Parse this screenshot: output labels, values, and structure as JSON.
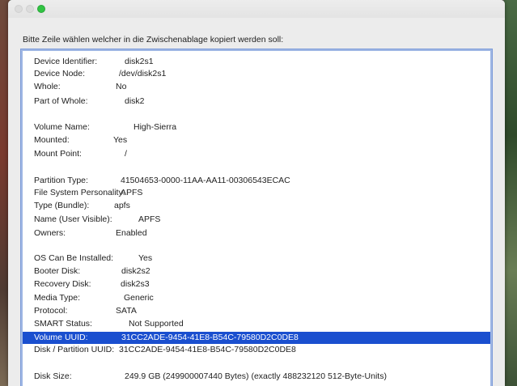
{
  "window": {
    "prompt": "Bitte Zeile wählen welcher in die Zwischenablage kopiert werden soll:"
  },
  "rows": [
    {
      "label": "Device Identifier:",
      "value": "disk2s1"
    },
    {
      "label": "Device Node:",
      "value": "/dev/disk2s1"
    },
    {
      "label": "Whole:",
      "value": "No"
    },
    {
      "label": "Part of Whole:",
      "value": "disk2"
    },
    {
      "label": "Volume Name:",
      "value": "High-Sierra"
    },
    {
      "label": "Mounted:",
      "value": "Yes"
    },
    {
      "label": "Mount Point:",
      "value": "/"
    },
    {
      "label": "Partition Type:",
      "value": "41504653-0000-11AA-AA11-00306543ECAC"
    },
    {
      "label": "File System Personality:",
      "value": "APFS"
    },
    {
      "label": "Type (Bundle):",
      "value": "apfs"
    },
    {
      "label": "Name (User Visible):",
      "value": "APFS"
    },
    {
      "label": "Owners:",
      "value": "Enabled"
    },
    {
      "label": "OS Can Be Installed:",
      "value": "Yes"
    },
    {
      "label": "Booter Disk:",
      "value": "disk2s2"
    },
    {
      "label": "Recovery Disk:",
      "value": "disk2s3"
    },
    {
      "label": "Media Type:",
      "value": "Generic"
    },
    {
      "label": "Protocol:",
      "value": "SATA"
    },
    {
      "label": "SMART Status:",
      "value": "Not Supported"
    },
    {
      "label": "Volume UUID:",
      "value": "31CC2ADE-9454-41E8-B54C-79580D2C0DE8",
      "selected": true
    },
    {
      "label": "Disk / Partition UUID:",
      "value": "31CC2ADE-9454-41E8-B54C-79580D2C0DE8"
    },
    {
      "label": "Disk Size:",
      "value": "249.9 GB (249900007440 Bytes) (exactly 488232120 512-Byte-Units)"
    }
  ],
  "colors": {
    "selection": "#1a4fcf",
    "focus_ring": "#9fb7e4",
    "zoom_button": "#31c443"
  }
}
